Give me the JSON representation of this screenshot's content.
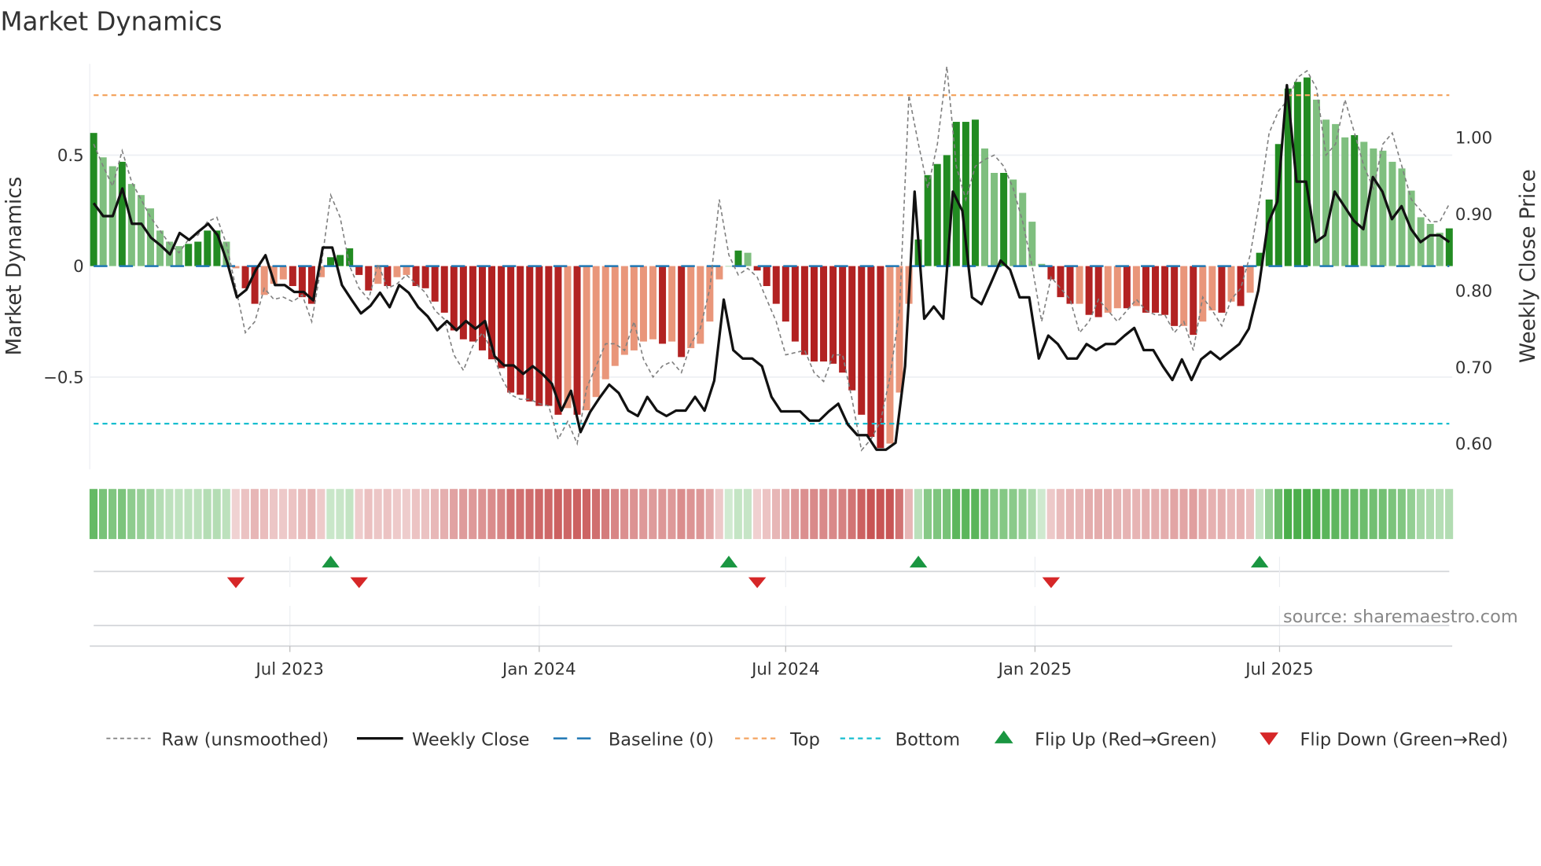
{
  "chart_data": {
    "type": "bar",
    "title": "Market Dynamics",
    "ylabel_left": "Market Dynamics",
    "ylabel_right": "Weekly Close Price",
    "source": "source: sharemaestro.com",
    "x_unit": "week index",
    "ylim_left": [
      -0.92,
      0.92
    ],
    "ylim_right": [
      0.575,
      1.105
    ],
    "left_ticks": [
      {
        "value": 0.5,
        "label": "0.5"
      },
      {
        "value": 0,
        "label": "0"
      },
      {
        "value": -0.5,
        "label": "−0.5"
      }
    ],
    "right_ticks": [
      {
        "value": 1.0,
        "label": "1.00"
      },
      {
        "value": 0.9,
        "label": "0.90"
      },
      {
        "value": 0.8,
        "label": "0.80"
      },
      {
        "value": 0.7,
        "label": "0.70"
      },
      {
        "value": 0.6,
        "label": "0.60"
      }
    ],
    "x_ticks": [
      {
        "week": 20.7,
        "label": "Jul 2023"
      },
      {
        "week": 47.0,
        "label": "Jan 2024"
      },
      {
        "week": 73.0,
        "label": "Jul 2024"
      },
      {
        "week": 99.3,
        "label": "Jan 2025"
      },
      {
        "week": 125.1,
        "label": "Jul 2025"
      }
    ],
    "top_level": 0.77,
    "bottom_level": -0.71,
    "baseline": 0,
    "smoothed": [
      0.6,
      0.49,
      0.45,
      0.47,
      0.37,
      0.32,
      0.26,
      0.16,
      0.11,
      0.09,
      0.1,
      0.11,
      0.16,
      0.16,
      0.11,
      -0.01,
      -0.1,
      -0.17,
      -0.13,
      -0.08,
      -0.06,
      -0.09,
      -0.14,
      -0.17,
      -0.05,
      0.04,
      0.05,
      0.08,
      -0.04,
      -0.11,
      -0.08,
      -0.09,
      -0.05,
      -0.04,
      -0.09,
      -0.1,
      -0.16,
      -0.21,
      -0.29,
      -0.33,
      -0.34,
      -0.38,
      -0.42,
      -0.46,
      -0.57,
      -0.58,
      -0.61,
      -0.63,
      -0.63,
      -0.67,
      -0.64,
      -0.67,
      -0.65,
      -0.59,
      -0.51,
      -0.45,
      -0.4,
      -0.38,
      -0.34,
      -0.33,
      -0.35,
      -0.34,
      -0.41,
      -0.37,
      -0.35,
      -0.25,
      -0.06,
      0.0,
      0.07,
      0.06,
      -0.02,
      -0.09,
      -0.17,
      -0.25,
      -0.34,
      -0.4,
      -0.43,
      -0.43,
      -0.44,
      -0.48,
      -0.56,
      -0.67,
      -0.77,
      -0.82,
      -0.8,
      -0.57,
      -0.17,
      0.12,
      0.41,
      0.46,
      0.5,
      0.65,
      0.65,
      0.66,
      0.53,
      0.42,
      0.42,
      0.39,
      0.33,
      0.2,
      0.01,
      -0.06,
      -0.14,
      -0.17,
      -0.17,
      -0.22,
      -0.23,
      -0.21,
      -0.19,
      -0.19,
      -0.18,
      -0.21,
      -0.21,
      -0.22,
      -0.27,
      -0.27,
      -0.31,
      -0.25,
      -0.2,
      -0.21,
      -0.16,
      -0.18,
      -0.12,
      0.06,
      0.3,
      0.55,
      0.8,
      0.83,
      0.85,
      0.75,
      0.66,
      0.64,
      0.58,
      0.59,
      0.56,
      0.53,
      0.52,
      0.47,
      0.44,
      0.34,
      0.22,
      0.19,
      0.15,
      0.17
    ],
    "strengthening": [
      1,
      0,
      0,
      1,
      0,
      0,
      0,
      0,
      0,
      0,
      1,
      1,
      1,
      1,
      0,
      0,
      1,
      1,
      0,
      0,
      0,
      1,
      1,
      1,
      0,
      1,
      1,
      1,
      1,
      1,
      0,
      1,
      0,
      0,
      1,
      1,
      1,
      1,
      1,
      1,
      1,
      1,
      1,
      1,
      1,
      1,
      1,
      1,
      1,
      1,
      0,
      1,
      0,
      0,
      0,
      0,
      0,
      0,
      0,
      0,
      1,
      0,
      1,
      0,
      0,
      0,
      0,
      0,
      1,
      0,
      1,
      1,
      1,
      1,
      1,
      1,
      1,
      1,
      1,
      1,
      1,
      1,
      1,
      1,
      0,
      0,
      0,
      1,
      1,
      1,
      1,
      1,
      1,
      1,
      0,
      0,
      1,
      0,
      0,
      0,
      0,
      1,
      1,
      1,
      0,
      1,
      1,
      0,
      0,
      1,
      0,
      1,
      1,
      1,
      1,
      0,
      1,
      0,
      0,
      1,
      0,
      1,
      0,
      1,
      1,
      1,
      1,
      1,
      1,
      0,
      0,
      0,
      0,
      1,
      0,
      0,
      0,
      0,
      0,
      0,
      0,
      0,
      0,
      1
    ],
    "raw": [
      0.55,
      0.45,
      0.36,
      0.52,
      0.38,
      0.3,
      0.22,
      0.16,
      0.1,
      0.06,
      0.12,
      0.14,
      0.2,
      0.22,
      0.1,
      -0.1,
      -0.3,
      -0.25,
      -0.1,
      -0.15,
      -0.14,
      -0.16,
      -0.13,
      -0.25,
      0.0,
      0.32,
      0.22,
      0.0,
      -0.1,
      -0.15,
      0.01,
      -0.1,
      -0.08,
      -0.04,
      -0.08,
      -0.12,
      -0.2,
      -0.24,
      -0.4,
      -0.47,
      -0.36,
      -0.3,
      -0.38,
      -0.5,
      -0.58,
      -0.6,
      -0.6,
      -0.62,
      -0.63,
      -0.78,
      -0.7,
      -0.8,
      -0.55,
      -0.45,
      -0.35,
      -0.35,
      -0.38,
      -0.25,
      -0.42,
      -0.5,
      -0.45,
      -0.43,
      -0.48,
      -0.35,
      -0.28,
      -0.1,
      0.3,
      0.05,
      -0.04,
      -0.01,
      -0.05,
      -0.15,
      -0.25,
      -0.4,
      -0.39,
      -0.38,
      -0.48,
      -0.52,
      -0.4,
      -0.4,
      -0.6,
      -0.83,
      -0.78,
      -0.7,
      -0.5,
      -0.2,
      0.77,
      0.55,
      0.35,
      0.55,
      0.9,
      0.45,
      0.3,
      0.45,
      0.48,
      0.5,
      0.45,
      0.35,
      0.2,
      0.0,
      -0.25,
      -0.05,
      -0.1,
      -0.15,
      -0.3,
      -0.25,
      -0.15,
      -0.2,
      -0.25,
      -0.2,
      -0.15,
      -0.2,
      -0.22,
      -0.22,
      -0.3,
      -0.25,
      -0.38,
      -0.14,
      -0.2,
      -0.27,
      -0.15,
      -0.1,
      0.05,
      0.3,
      0.6,
      0.7,
      0.75,
      0.85,
      0.88,
      0.8,
      0.5,
      0.55,
      0.75,
      0.6,
      0.45,
      0.35,
      0.55,
      0.6,
      0.45,
      0.3,
      0.25,
      0.2,
      0.2,
      0.28
    ],
    "weekly_close": [
      0.913,
      0.896,
      0.896,
      0.932,
      0.886,
      0.886,
      0.868,
      0.858,
      0.846,
      0.874,
      0.865,
      0.876,
      0.886,
      0.871,
      0.835,
      0.79,
      0.8,
      0.826,
      0.845,
      0.806,
      0.806,
      0.797,
      0.797,
      0.786,
      0.855,
      0.855,
      0.806,
      0.787,
      0.769,
      0.779,
      0.796,
      0.777,
      0.806,
      0.796,
      0.777,
      0.765,
      0.747,
      0.759,
      0.747,
      0.759,
      0.749,
      0.759,
      0.713,
      0.701,
      0.701,
      0.69,
      0.7,
      0.69,
      0.677,
      0.642,
      0.668,
      0.614,
      0.64,
      0.659,
      0.676,
      0.665,
      0.642,
      0.635,
      0.66,
      0.642,
      0.635,
      0.642,
      0.642,
      0.66,
      0.642,
      0.681,
      0.787,
      0.721,
      0.71,
      0.71,
      0.7,
      0.66,
      0.641,
      0.641,
      0.641,
      0.629,
      0.629,
      0.641,
      0.651,
      0.624,
      0.61,
      0.61,
      0.591,
      0.591,
      0.6,
      0.7,
      0.928,
      0.762,
      0.778,
      0.762,
      0.928,
      0.903,
      0.79,
      0.781,
      0.809,
      0.838,
      0.826,
      0.79,
      0.79,
      0.71,
      0.74,
      0.729,
      0.71,
      0.71,
      0.729,
      0.721,
      0.729,
      0.729,
      0.74,
      0.75,
      0.721,
      0.721,
      0.7,
      0.682,
      0.709,
      0.682,
      0.709,
      0.719,
      0.709,
      0.719,
      0.729,
      0.749,
      0.799,
      0.886,
      0.915,
      1.067,
      0.941,
      0.941,
      0.862,
      0.871,
      0.928,
      0.909,
      0.89,
      0.879,
      0.947,
      0.928,
      0.892,
      0.909,
      0.879,
      0.862,
      0.871,
      0.871,
      0.862
    ],
    "flip_up_weeks": [
      25,
      67,
      87,
      123
    ],
    "flip_down_weeks": [
      15,
      28,
      70,
      101
    ],
    "colors": {
      "green_strong": "#228b22",
      "green_weak": "#7fbf7f",
      "red_strong": "#b22222",
      "red_weak": "#e9967a",
      "baseline": "#1f77b4",
      "top": "#f4a460",
      "bottom": "#17becf",
      "raw": "#808080",
      "close": "#111111",
      "flip_up": "#1a9641",
      "flip_down": "#d62728"
    },
    "legend": [
      {
        "key": "raw",
        "label": "Raw (unsmoothed)"
      },
      {
        "key": "close",
        "label": "Weekly Close"
      },
      {
        "key": "baseline",
        "label": "Baseline (0)"
      },
      {
        "key": "top",
        "label": "Top"
      },
      {
        "key": "bottom",
        "label": "Bottom"
      },
      {
        "key": "flip_up",
        "label": "Flip Up (Red→Green)"
      },
      {
        "key": "flip_down",
        "label": "Flip Down (Green→Red)"
      }
    ],
    "legend_position": "bottom"
  }
}
